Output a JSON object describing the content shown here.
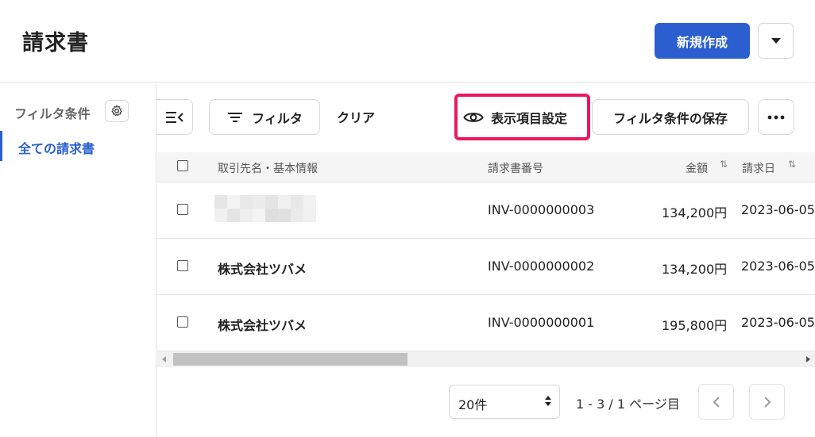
{
  "header": {
    "title": "請求書",
    "new_button": "新規作成"
  },
  "sidebar": {
    "title": "フィルタ条件",
    "active_item": "全ての請求書"
  },
  "toolbar": {
    "filter_label": "フィルタ",
    "clear_label": "クリア",
    "display_settings_label": "表示項目設定",
    "save_filter_label": "フィルタ条件の保存"
  },
  "table": {
    "headers": {
      "name": "取引先名・基本情報",
      "number": "請求書番号",
      "amount": "金額",
      "date": "請求日"
    },
    "rows": [
      {
        "name": "",
        "number": "INV-0000000003",
        "amount": "134,200円",
        "date": "2023-06-05"
      },
      {
        "name": "株式会社ツバメ",
        "number": "INV-0000000002",
        "amount": "134,200円",
        "date": "2023-06-05"
      },
      {
        "name": "株式会社ツバメ",
        "number": "INV-0000000001",
        "amount": "195,800円",
        "date": "2023-06-05"
      }
    ]
  },
  "pagination": {
    "per_page": "20件",
    "info": "1 - 3 / 1 ページ目"
  },
  "colors": {
    "accent": "#2b5fd0",
    "highlight": "#e8185f"
  }
}
